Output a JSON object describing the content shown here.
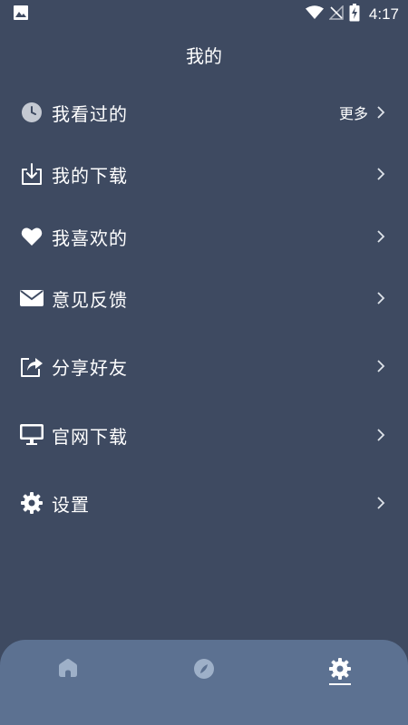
{
  "status_bar": {
    "time": "4:17",
    "icons": [
      "image-icon",
      "wifi-icon",
      "no-signal-icon",
      "battery-charging-icon"
    ]
  },
  "header": {
    "title": "我的"
  },
  "menu": {
    "items": [
      {
        "label": "我看过的",
        "icon": "clock-icon",
        "more": "更多"
      },
      {
        "label": "我的下载",
        "icon": "download-icon"
      },
      {
        "label": "我喜欢的",
        "icon": "heart-icon"
      },
      {
        "label": "意见反馈",
        "icon": "mail-icon"
      },
      {
        "label": "分享好友",
        "icon": "share-icon"
      },
      {
        "label": "官网下载",
        "icon": "monitor-icon"
      },
      {
        "label": "设置",
        "icon": "gear-icon"
      }
    ]
  },
  "bottom_nav": {
    "tabs": [
      {
        "icon": "home-icon",
        "active": false
      },
      {
        "icon": "compass-icon",
        "active": false
      },
      {
        "icon": "gear-icon",
        "active": true
      }
    ]
  },
  "colors": {
    "background": "#3e4a61",
    "bottom_nav": "#5c7191",
    "nav_icon_inactive": "#9eb0c8",
    "text": "#ffffff"
  }
}
